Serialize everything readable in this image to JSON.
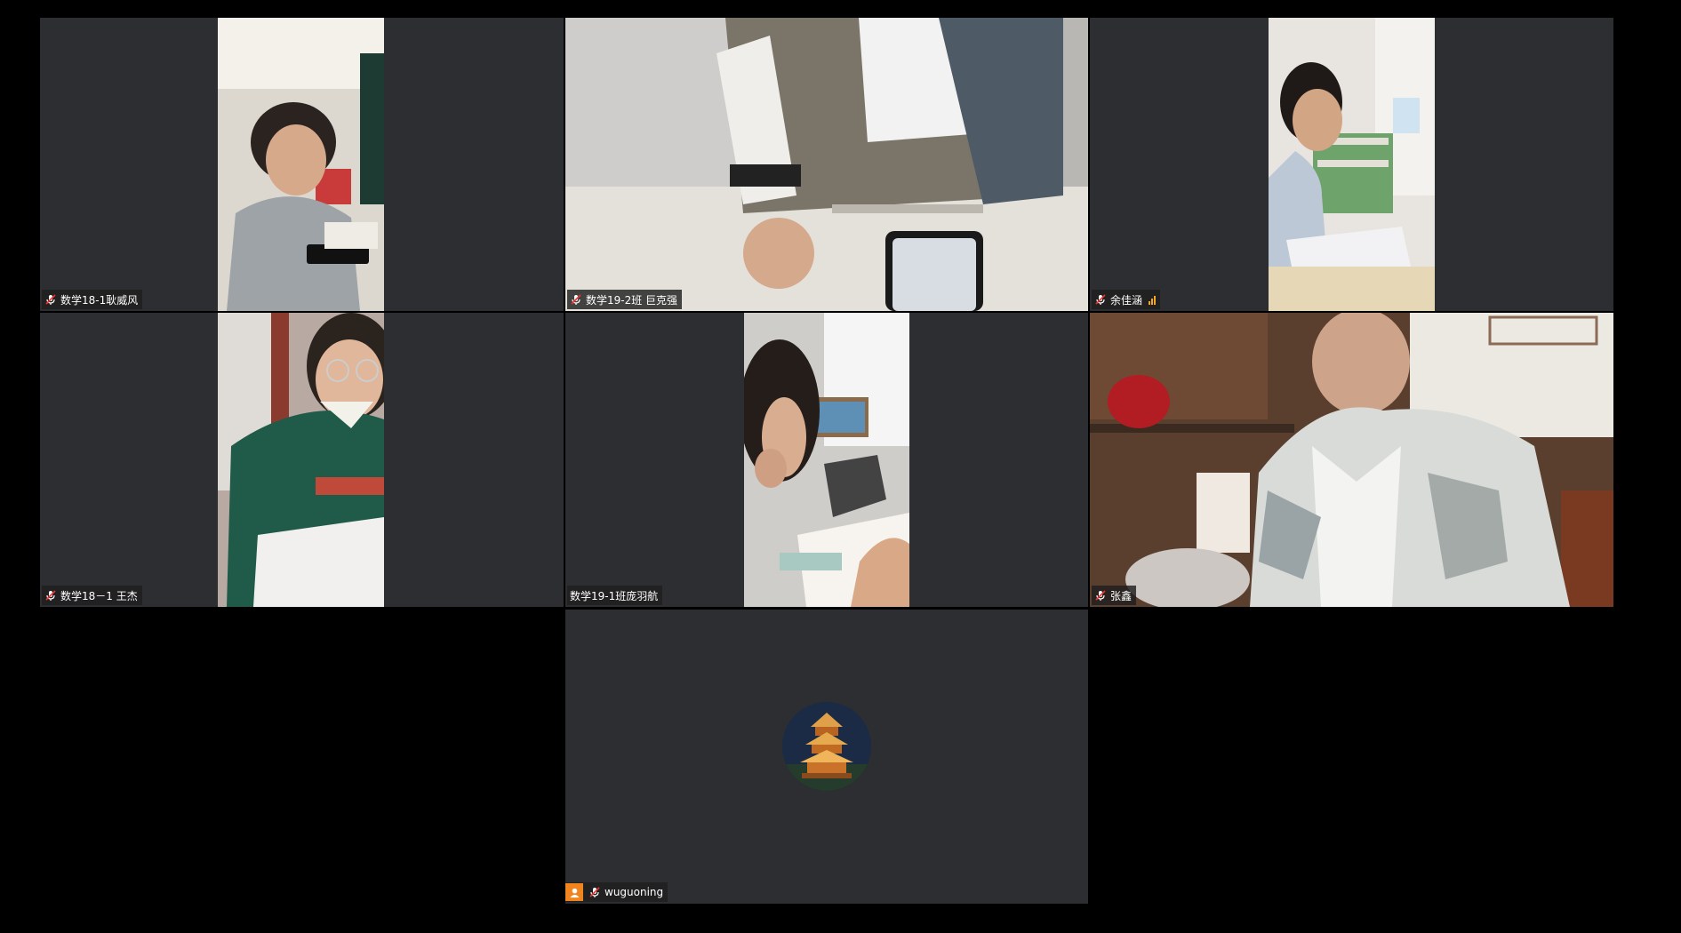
{
  "participants": [
    {
      "name": "数学18-1耿威风",
      "muted": true
    },
    {
      "name": "数学19-2班  巨克强",
      "muted": true
    },
    {
      "name": "余佳涵",
      "muted": true,
      "signal": true
    },
    {
      "name": "数学18－1 王杰",
      "muted": true
    },
    {
      "name": "数学19-1班庞羽航",
      "muted": false
    },
    {
      "name": "张鑫",
      "muted": true
    },
    {
      "name": "wuguoning",
      "muted": true,
      "avatar": "pagoda-avatar"
    }
  ],
  "colors": {
    "tile_bg": "#2c2e31",
    "page_bg": "#000000",
    "name_tag_bg": "#1e1e1e",
    "signal": "#f5a623",
    "user_badge": "#f0851f"
  }
}
